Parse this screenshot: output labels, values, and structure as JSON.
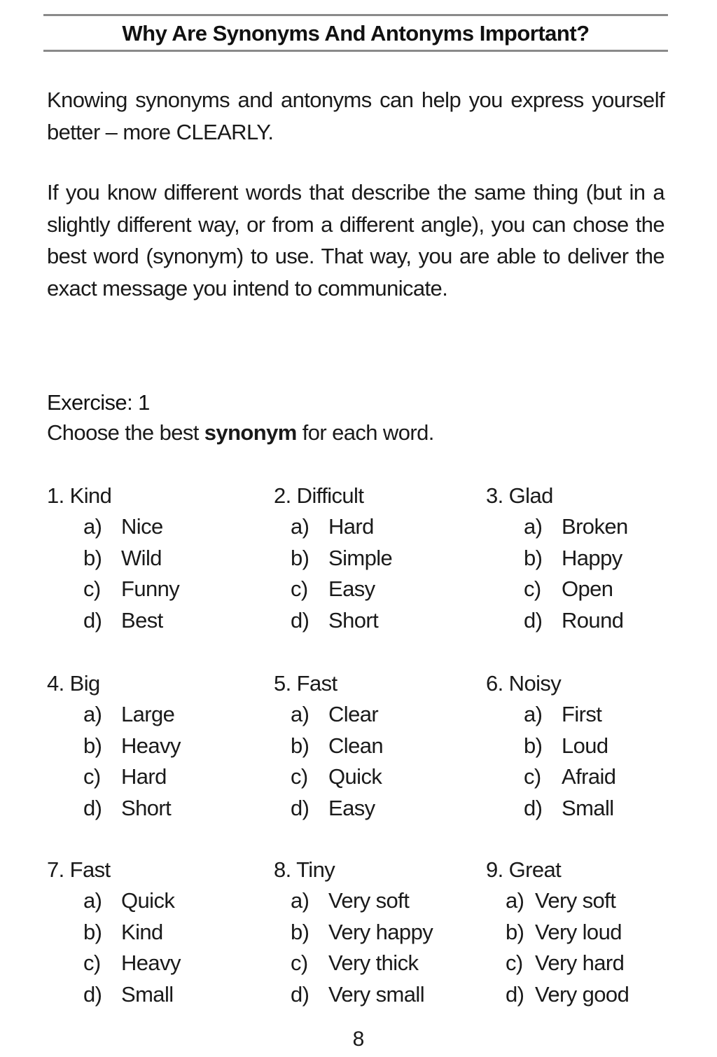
{
  "header": {
    "title": "Why Are Synonyms And Antonyms Important?"
  },
  "intro": {
    "paragraph1": "Knowing synonyms and antonyms can help you express yourself better – more CLEARLY.",
    "paragraph2": "If you know different words that describe the same thing (but in a slightly different way, or from a different angle), you can chose the best word (synonym) to use. That way, you are able to deliver the exact message you intend to communicate."
  },
  "exercise": {
    "heading": "Exercise: 1",
    "instruction_before": "Choose the best ",
    "instruction_bold": "synonym",
    "instruction_after": " for each word.",
    "questions": [
      {
        "label": "1. Kind",
        "options": [
          {
            "letter": "a)",
            "text": "Nice"
          },
          {
            "letter": "b)",
            "text": "Wild"
          },
          {
            "letter": "c)",
            "text": "Funny"
          },
          {
            "letter": "d)",
            "text": "Best"
          }
        ]
      },
      {
        "label": "2. Difficult",
        "options": [
          {
            "letter": "a)",
            "text": "Hard"
          },
          {
            "letter": "b)",
            "text": "Simple"
          },
          {
            "letter": "c)",
            "text": "Easy"
          },
          {
            "letter": "d)",
            "text": "Short"
          }
        ]
      },
      {
        "label": "3. Glad",
        "options": [
          {
            "letter": "a)",
            "text": "Broken"
          },
          {
            "letter": "b)",
            "text": "Happy"
          },
          {
            "letter": "c)",
            "text": "Open"
          },
          {
            "letter": "d)",
            "text": "Round"
          }
        ]
      },
      {
        "label": "4. Big",
        "options": [
          {
            "letter": "a)",
            "text": "Large"
          },
          {
            "letter": "b)",
            "text": "Heavy"
          },
          {
            "letter": "c)",
            "text": "Hard"
          },
          {
            "letter": "d)",
            "text": "Short"
          }
        ]
      },
      {
        "label": "5. Fast",
        "options": [
          {
            "letter": "a)",
            "text": "Clear"
          },
          {
            "letter": "b)",
            "text": "Clean"
          },
          {
            "letter": "c)",
            "text": "Quick"
          },
          {
            "letter": "d)",
            "text": "Easy"
          }
        ]
      },
      {
        "label": "6. Noisy",
        "options": [
          {
            "letter": "a)",
            "text": "First"
          },
          {
            "letter": "b)",
            "text": "Loud"
          },
          {
            "letter": "c)",
            "text": "Afraid"
          },
          {
            "letter": "d)",
            "text": "Small"
          }
        ]
      },
      {
        "label": "7. Fast",
        "options": [
          {
            "letter": "a)",
            "text": "Quick"
          },
          {
            "letter": "b)",
            "text": "Kind"
          },
          {
            "letter": "c)",
            "text": "Heavy"
          },
          {
            "letter": "d)",
            "text": "Small"
          }
        ]
      },
      {
        "label": "8. Tiny",
        "options": [
          {
            "letter": "a)",
            "text": "Very soft"
          },
          {
            "letter": "b)",
            "text": "Very happy"
          },
          {
            "letter": "c)",
            "text": "Very thick"
          },
          {
            "letter": "d)",
            "text": "Very small"
          }
        ]
      },
      {
        "label": "9. Great",
        "options": [
          {
            "letter": "a)",
            "text": "Very soft"
          },
          {
            "letter": "b)",
            "text": "Very loud"
          },
          {
            "letter": "c)",
            "text": "Very hard"
          },
          {
            "letter": "d)",
            "text": "Very good"
          }
        ]
      }
    ]
  },
  "footer": {
    "page_number": "8"
  }
}
